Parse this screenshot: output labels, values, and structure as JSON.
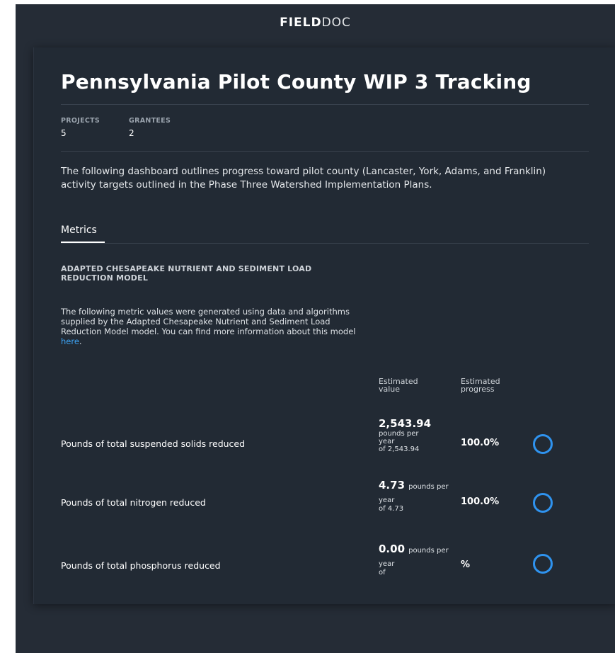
{
  "brand": {
    "bold": "FIELD",
    "light": "DOC"
  },
  "page_title": "Pennsylvania Pilot County WIP 3 Tracking",
  "stats": {
    "projects": {
      "label": "PROJECTS",
      "value": "5"
    },
    "grantees": {
      "label": "GRANTEES",
      "value": "2"
    }
  },
  "description": "The following dashboard outlines progress toward pilot county (Lancaster, York, Adams, and Franklin) activity targets outlined in the Phase Three Watershed Implementation Plans.",
  "tabs": {
    "metrics": "Metrics"
  },
  "model": {
    "title": "ADAPTED CHESAPEAKE NUTRIENT AND SEDIMENT LOAD REDUCTION MODEL",
    "description": "The following metric values were generated using data and algorithms supplied by the Adapted Chesapeake Nutrient and Sediment Load Reduction Model model. You can find more information about this model",
    "link_text": "here"
  },
  "columns": {
    "estimated_value": "Estimated value",
    "estimated_progress": "Estimated progress"
  },
  "metrics": [
    {
      "name": "Pounds of total suspended solids reduced",
      "value": "2,543.94",
      "unit": "pounds per year",
      "target": "of 2,543.94",
      "progress": "100.0%",
      "progress_value": 1.0
    },
    {
      "name": "Pounds of total nitrogen reduced",
      "value": "4.73",
      "unit": "pounds per year",
      "target": "of 4.73",
      "progress": "100.0%",
      "progress_value": 1.0
    },
    {
      "name": "Pounds of total phosphorus reduced",
      "value": "0.00",
      "unit": "pounds per year",
      "target": "of",
      "progress": "%",
      "progress_value": 0
    }
  ],
  "colors": {
    "accent": "#2f93ef",
    "link": "#3da4f5",
    "background": "#252c36",
    "card": "#222a34"
  }
}
